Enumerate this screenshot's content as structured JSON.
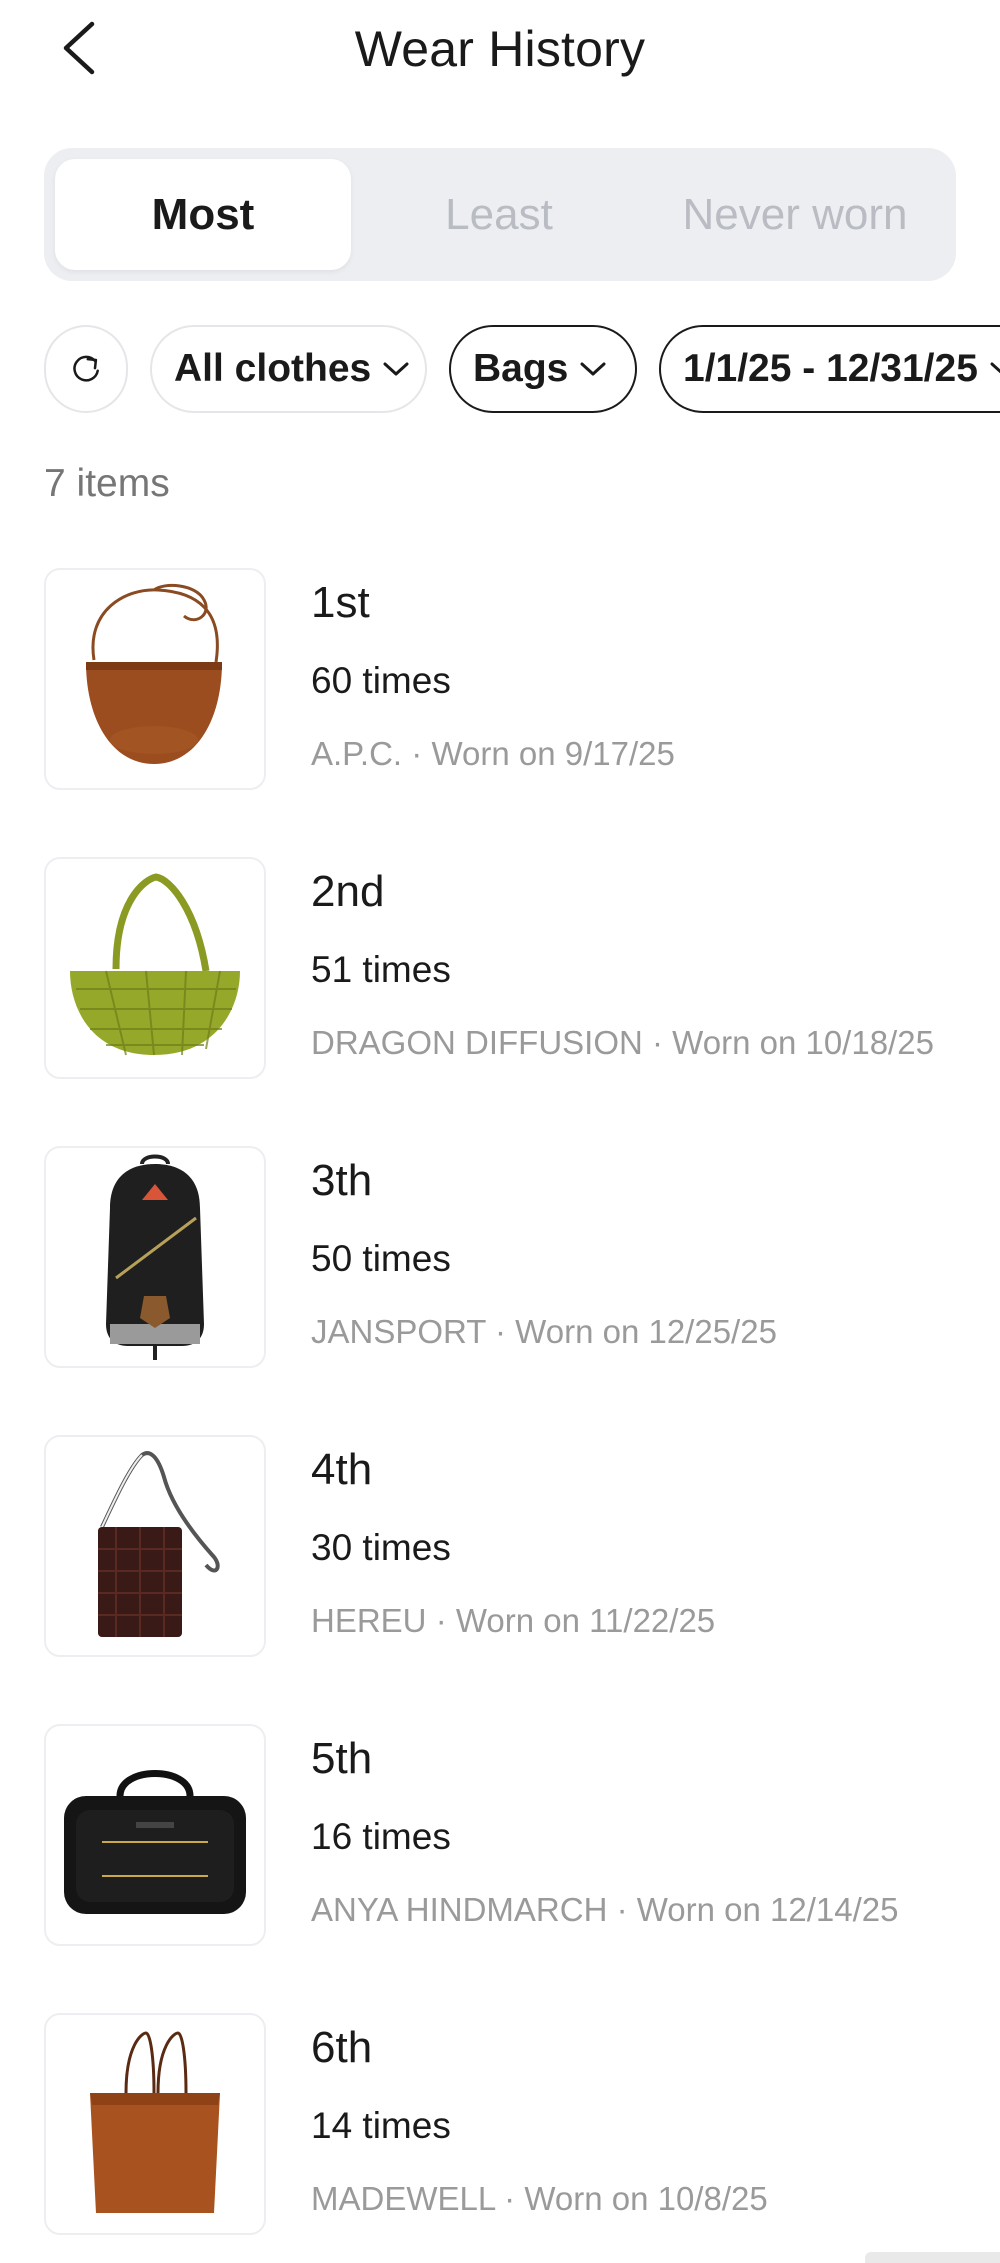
{
  "header": {
    "title": "Wear History",
    "back_icon": "chevron-left-icon"
  },
  "tabs": [
    {
      "label": "Most",
      "active": true
    },
    {
      "label": "Least",
      "active": false
    },
    {
      "label": "Never worn",
      "active": false
    }
  ],
  "filters": {
    "refresh_icon": "refresh-icon",
    "category": "All clothes",
    "subcategory": "Bags",
    "date_range": "1/1/25 - 12/31/25"
  },
  "count_label": "7 items",
  "items": [
    {
      "rank": "1st",
      "times": "60 times",
      "brand": "A.P.C.",
      "worn": "Worn on 9/17/25",
      "thumb": "brown-crossbody-bag"
    },
    {
      "rank": "2nd",
      "times": "51 times",
      "brand": "DRAGON DIFFUSION",
      "worn": "Worn on 10/18/25",
      "thumb": "green-woven-bag"
    },
    {
      "rank": "3th",
      "times": "50 times",
      "brand": "JANSPORT",
      "worn": "Worn on 12/25/25",
      "thumb": "black-backpack"
    },
    {
      "rank": "4th",
      "times": "30 times",
      "brand": "HEREU",
      "worn": "Worn on 11/22/25",
      "thumb": "woven-pouch-bag"
    },
    {
      "rank": "5th",
      "times": "16 times",
      "brand": "ANYA HINDMARCH",
      "worn": "Worn on 12/14/25",
      "thumb": "black-nylon-bag"
    },
    {
      "rank": "6th",
      "times": "14 times",
      "brand": "MADEWELL",
      "worn": "Worn on 10/8/25",
      "thumb": "brown-tote-bag"
    }
  ],
  "colors": {
    "text": "#1a1a1a",
    "muted": "#9a9a9a",
    "segment_bg": "#eceef2",
    "inactive_tab": "#b9bcc3"
  }
}
